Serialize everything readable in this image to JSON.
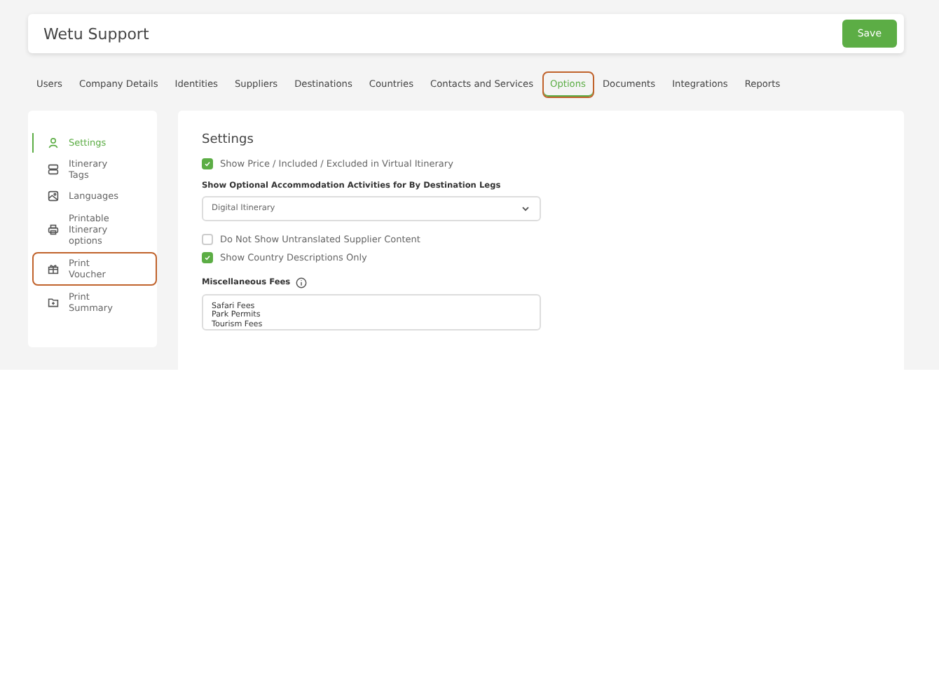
{
  "header": {
    "title": "Wetu Support",
    "save_button": "Save"
  },
  "tabs": [
    {
      "label": "Users",
      "selected": false,
      "highlighted": false
    },
    {
      "label": "Company Details",
      "selected": false,
      "highlighted": false
    },
    {
      "label": "Identities",
      "selected": false,
      "highlighted": false
    },
    {
      "label": "Suppliers",
      "selected": false,
      "highlighted": false
    },
    {
      "label": "Destinations",
      "selected": false,
      "highlighted": false
    },
    {
      "label": "Countries",
      "selected": false,
      "highlighted": false
    },
    {
      "label": "Contacts and Services",
      "selected": false,
      "highlighted": false
    },
    {
      "label": "Options",
      "selected": true,
      "highlighted": true
    },
    {
      "label": "Documents",
      "selected": false,
      "highlighted": false
    },
    {
      "label": "Integrations",
      "selected": false,
      "highlighted": false
    },
    {
      "label": "Reports",
      "selected": false,
      "highlighted": false
    }
  ],
  "sidebar": {
    "items": [
      {
        "label": "Settings",
        "selected": true,
        "highlighted": false
      },
      {
        "label": "Itinerary Tags",
        "selected": false,
        "highlighted": false
      },
      {
        "label": "Languages",
        "selected": false,
        "highlighted": false
      },
      {
        "label": "Printable Itinerary options",
        "selected": false,
        "highlighted": false
      },
      {
        "label": "Print Voucher",
        "selected": false,
        "highlighted": true
      },
      {
        "label": "Print Summary",
        "selected": false,
        "highlighted": false
      }
    ]
  },
  "settings": {
    "title": "Settings",
    "show_price": {
      "label": "Show Price / Included / Excluded in Virtual Itinerary",
      "checked": true
    },
    "optional_activities": {
      "label": "Show Optional Accommodation Activities for By Destination Legs",
      "value": "Digital Itinerary"
    },
    "checkboxes": [
      {
        "label": "Do Not Show Untranslated Supplier Content",
        "checked": false
      },
      {
        "label": "Show Country Descriptions Only",
        "checked": true
      }
    ],
    "misc_fees": {
      "label": "Miscellaneous Fees",
      "lines": [
        "Safari Fees",
        "Park Permits",
        "Tourism Fees"
      ]
    }
  }
}
